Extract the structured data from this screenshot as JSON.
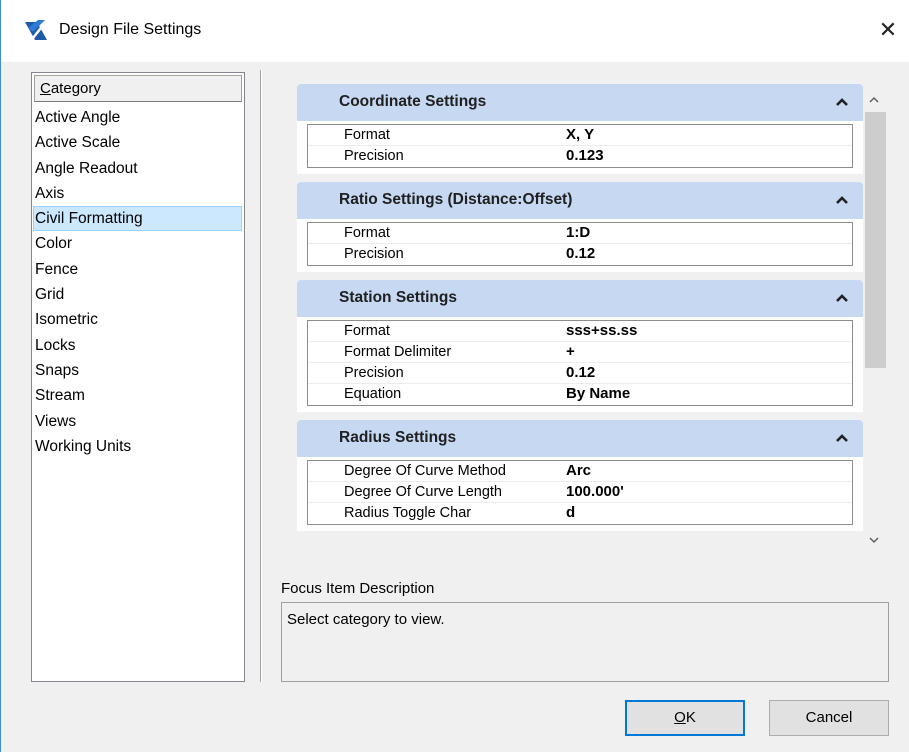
{
  "window": {
    "title": "Design File Settings",
    "close_glyph": "✕",
    "app_icon": "bentley-app-icon"
  },
  "category_list": {
    "header_underlined": "C",
    "header_rest": "ategory",
    "items": [
      "Active Angle",
      "Active Scale",
      "Angle Readout",
      "Axis",
      "Civil Formatting",
      "Color",
      "Fence",
      "Grid",
      "Isometric",
      "Locks",
      "Snaps",
      "Stream",
      "Views",
      "Working Units"
    ],
    "selected": "Civil Formatting"
  },
  "sections": [
    {
      "title": "Coordinate Settings",
      "rows": [
        {
          "label": "Format",
          "value": "X, Y"
        },
        {
          "label": "Precision",
          "value": "0.123"
        }
      ]
    },
    {
      "title": "Ratio Settings (Distance:Offset)",
      "rows": [
        {
          "label": "Format",
          "value": "1:D"
        },
        {
          "label": "Precision",
          "value": "0.12"
        }
      ]
    },
    {
      "title": "Station Settings",
      "rows": [
        {
          "label": "Format",
          "value": "sss+ss.ss"
        },
        {
          "label": "Format Delimiter",
          "value": "+"
        },
        {
          "label": "Precision",
          "value": "0.12"
        },
        {
          "label": "Equation",
          "value": "By Name"
        }
      ]
    },
    {
      "title": "Radius Settings",
      "rows": [
        {
          "label": "Degree Of Curve Method",
          "value": "Arc"
        },
        {
          "label": "Degree Of Curve Length",
          "value": "100.000'"
        },
        {
          "label": "Radius Toggle Char",
          "value": "d"
        }
      ]
    }
  ],
  "focus": {
    "label": "Focus Item Description",
    "text": "Select category to view."
  },
  "buttons": {
    "ok_underlined": "O",
    "ok_rest": "K",
    "cancel": "Cancel"
  },
  "colors": {
    "section_header": "#c7d9f2",
    "selection": "#cce8ff",
    "accent": "#0078d7"
  }
}
